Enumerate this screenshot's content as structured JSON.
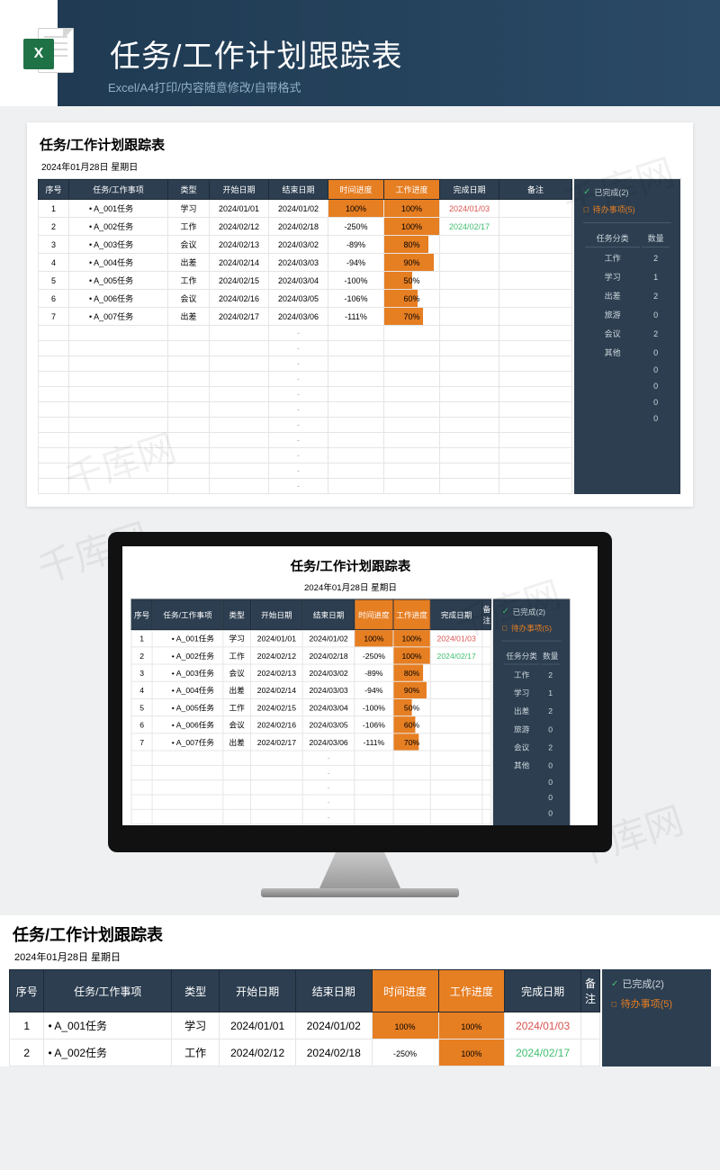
{
  "header": {
    "icon_letter": "X",
    "title": "任务/工作计划跟踪表",
    "subtitle": "Excel/A4打印/内容随意修改/自带格式"
  },
  "sheet": {
    "title": "任务/工作计划跟踪表",
    "date_line": "2024年01月28日  星期日",
    "columns": {
      "seq": "序号",
      "task": "任务/工作事项",
      "type": "类型",
      "start": "开始日期",
      "end": "结束日期",
      "time_prog": "时间进度",
      "work_prog": "工作进度",
      "done": "完成日期",
      "note": "备注"
    },
    "rows": [
      {
        "seq": "1",
        "task": "A_001任务",
        "type": "学习",
        "start": "2024/01/01",
        "end": "2024/01/02",
        "tp": "100%",
        "tpFill": 100,
        "wp": "100%",
        "wpFill": 100,
        "done": "2024/01/03",
        "doneCls": "done-red"
      },
      {
        "seq": "2",
        "task": "A_002任务",
        "type": "工作",
        "start": "2024/02/12",
        "end": "2024/02/18",
        "tp": "-250%",
        "tpFill": 0,
        "wp": "100%",
        "wpFill": 100,
        "done": "2024/02/17",
        "doneCls": "done-green"
      },
      {
        "seq": "3",
        "task": "A_003任务",
        "type": "会议",
        "start": "2024/02/13",
        "end": "2024/03/02",
        "tp": "-89%",
        "tpFill": 0,
        "wp": "80%",
        "wpFill": 80,
        "done": "",
        "doneCls": ""
      },
      {
        "seq": "4",
        "task": "A_004任务",
        "type": "出差",
        "start": "2024/02/14",
        "end": "2024/03/03",
        "tp": "-94%",
        "tpFill": 0,
        "wp": "90%",
        "wpFill": 90,
        "done": "",
        "doneCls": ""
      },
      {
        "seq": "5",
        "task": "A_005任务",
        "type": "工作",
        "start": "2024/02/15",
        "end": "2024/03/04",
        "tp": "-100%",
        "tpFill": 0,
        "wp": "50%",
        "wpFill": 50,
        "done": "",
        "doneCls": ""
      },
      {
        "seq": "6",
        "task": "A_006任务",
        "type": "会议",
        "start": "2024/02/16",
        "end": "2024/03/05",
        "tp": "-106%",
        "tpFill": 0,
        "wp": "60%",
        "wpFill": 60,
        "done": "",
        "doneCls": ""
      },
      {
        "seq": "7",
        "task": "A_007任务",
        "type": "出差",
        "start": "2024/02/17",
        "end": "2024/03/06",
        "tp": "-111%",
        "tpFill": 0,
        "wp": "70%",
        "wpFill": 70,
        "done": "",
        "doneCls": ""
      }
    ],
    "empty_rows": 11
  },
  "side": {
    "done_label": "已完成(2)",
    "todo_label": "待办事项(5)",
    "cat_head": {
      "a": "任务分类",
      "b": "数量"
    },
    "cats": [
      {
        "k": "工作",
        "v": "2"
      },
      {
        "k": "学习",
        "v": "1"
      },
      {
        "k": "出差",
        "v": "2"
      },
      {
        "k": "旅游",
        "v": "0"
      },
      {
        "k": "会议",
        "v": "2"
      },
      {
        "k": "其他",
        "v": "0"
      },
      {
        "k": "",
        "v": "0"
      },
      {
        "k": "",
        "v": "0"
      },
      {
        "k": "",
        "v": "0"
      },
      {
        "k": "",
        "v": "0"
      }
    ]
  },
  "watermark": "千库网",
  "snippet_rows": 2
}
